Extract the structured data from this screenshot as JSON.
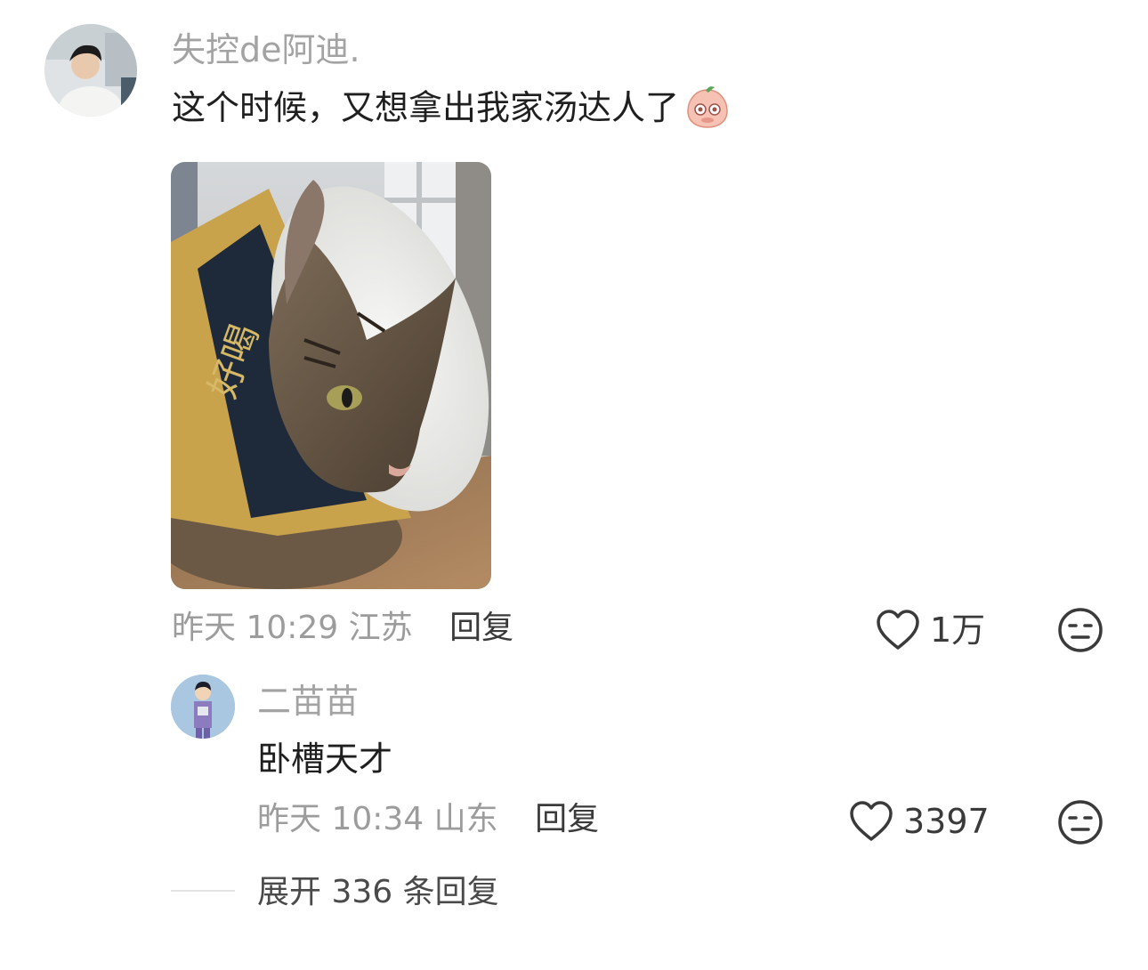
{
  "main_comment": {
    "username": "失控de阿迪.",
    "text": "这个时候，又想拿出我家汤达人了",
    "emoji": "peach-face-sticker",
    "time": "昨天 10:29",
    "location": "江苏",
    "reply_label": "回复",
    "likes": "1万",
    "like_icon": "heart-outline-icon",
    "dislike_icon": "meh-face-icon",
    "photo": "cat-in-noodle-cup-photo"
  },
  "reply_comment": {
    "username": "二苗苗",
    "text": "卧槽天才",
    "time": "昨天 10:34",
    "location": "山东",
    "reply_label": "回复",
    "likes": "3397"
  },
  "expand": {
    "label": "展开 336 条回复"
  },
  "colors": {
    "secondary_text": "#a3a3a3",
    "primary_text": "#1f1f1f"
  }
}
